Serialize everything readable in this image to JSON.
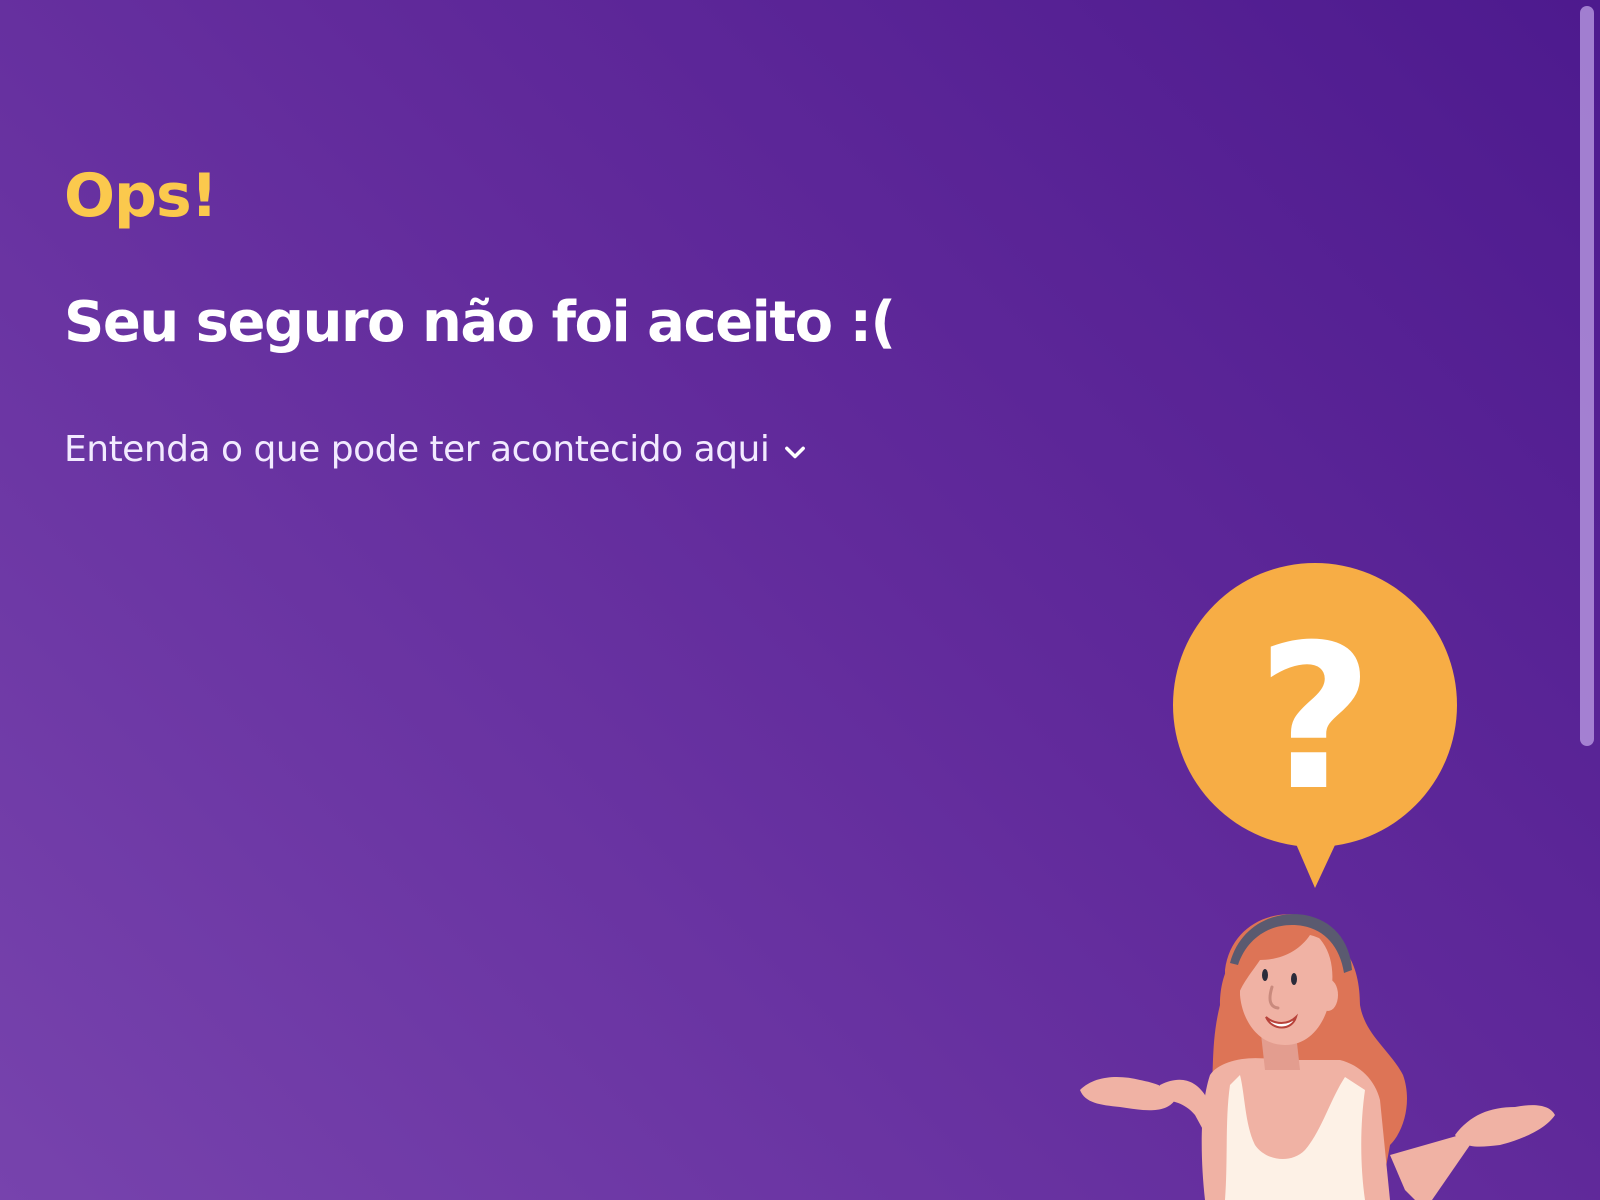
{
  "page": {
    "kicker": "Ops!",
    "title": "Seu seguro não foi aceito :(",
    "details_toggle": {
      "label": "Entenda o que pode ter acontecido aqui",
      "icon": "chevron-down-icon"
    }
  },
  "illustration": {
    "bubble_text": "?",
    "bubble_color": "#f7ad45",
    "subject": "woman-shrugging-illustration"
  },
  "colors": {
    "background_start": "#4d1a8e",
    "background_end": "#7743ad",
    "kicker": "#fbc94d",
    "title": "#ffffff"
  }
}
